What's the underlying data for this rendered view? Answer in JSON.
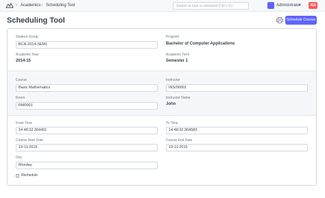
{
  "navbar": {
    "breadcrumbs": [
      "Academics",
      "Scheduling Tool"
    ],
    "search_placeholder": "Search or type a command (Ctrl + G)",
    "user_name": "Administrator",
    "notification_count": "416"
  },
  "page": {
    "title": "Scheduling Tool",
    "primary_action": "Schedule Course"
  },
  "form": {
    "student_group": {
      "label": "Student Group",
      "value": "BCA-2014-SEM1"
    },
    "program": {
      "label": "Program",
      "value": "Bachelor of Computer Applications"
    },
    "academic_year": {
      "label": "Academic Year",
      "value": "2014-15"
    },
    "academic_term": {
      "label": "Academic Term",
      "value": "Semester 1"
    },
    "course": {
      "label": "Course",
      "value": "Basic Mathematics"
    },
    "instructor": {
      "label": "Instructor",
      "value": "INS/00001"
    },
    "room": {
      "label": "Room",
      "value": "RM0001"
    },
    "instructor_name": {
      "label": "Instructor Name",
      "value": "John"
    },
    "from_time": {
      "label": "From Time",
      "value": "14:48:32.364491"
    },
    "to_time": {
      "label": "To Time",
      "value": "14:48:32.364583"
    },
    "course_start_date": {
      "label": "Course Start Date",
      "value": "19-11-2015"
    },
    "course_end_date": {
      "label": "Course End Date",
      "value": "19-11-2015"
    },
    "day": {
      "label": "Day",
      "value": "Monday"
    },
    "reschedule": {
      "label": "Rechedule",
      "checked": false
    }
  },
  "colors": {
    "accent": "#5e64ff",
    "notification": "#ff5858"
  }
}
